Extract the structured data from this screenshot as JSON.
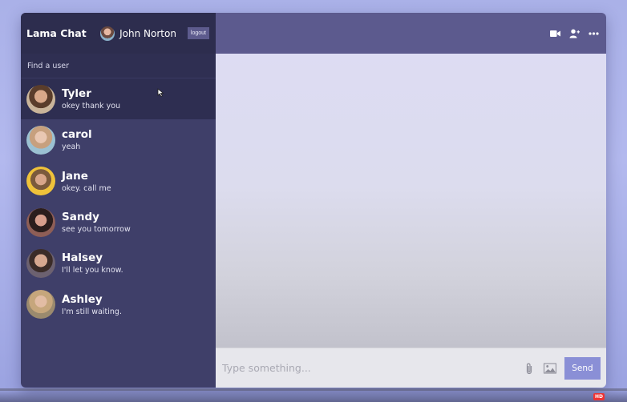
{
  "app": {
    "title": "Lama Chat",
    "current_user": "John Norton",
    "logout_label": "logout"
  },
  "search": {
    "placeholder": "Find a user"
  },
  "chats": [
    {
      "name": "Tyler",
      "last_message": "okey thank you",
      "active": true
    },
    {
      "name": "carol",
      "last_message": "yeah",
      "active": false
    },
    {
      "name": "Jane",
      "last_message": "okey. call me",
      "active": false
    },
    {
      "name": "Sandy",
      "last_message": "see you tomorrow",
      "active": false
    },
    {
      "name": "Halsey",
      "last_message": "I'll let you know.",
      "active": false
    },
    {
      "name": "Ashley",
      "last_message": "I'm still waiting.",
      "active": false
    }
  ],
  "header_icons": [
    "video-camera-icon",
    "add-user-icon",
    "more-options-icon"
  ],
  "composer": {
    "placeholder": "Type something...",
    "send_label": "Send",
    "icons": [
      "paperclip-icon",
      "image-icon"
    ]
  },
  "video_overlay": {
    "badge": "HD"
  },
  "colors": {
    "navbar": "#2d2d4e",
    "sidebar": "#3f3f69",
    "chat_header": "#5c5a8e",
    "send_button": "#8a8fd6",
    "message_area": "#dddcf3"
  }
}
